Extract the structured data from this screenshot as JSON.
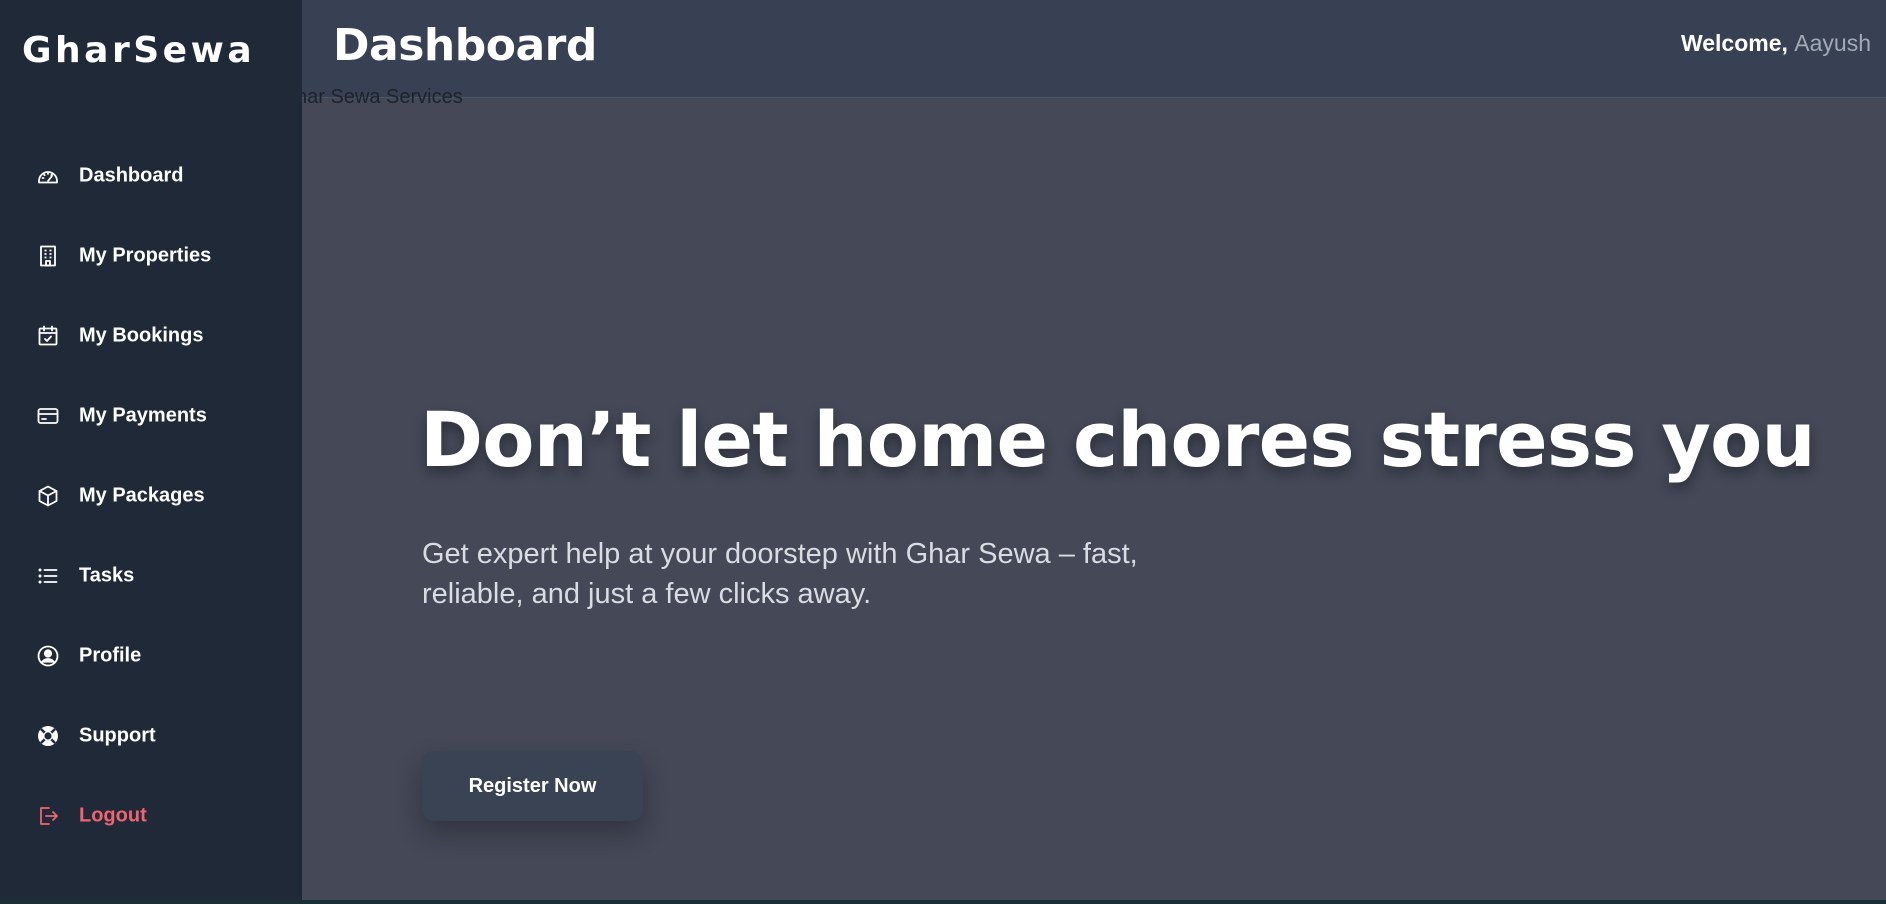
{
  "brand": {
    "name": "GharSewa"
  },
  "header": {
    "title": "Dashboard",
    "welcome_prefix": "Welcome,",
    "user_name": "Aayush"
  },
  "background_text": "har Sewa Services",
  "sidebar": {
    "items": [
      {
        "label": "Dashboard",
        "icon": "dashboard-gauge-icon"
      },
      {
        "label": "My Properties",
        "icon": "building-icon"
      },
      {
        "label": "My Bookings",
        "icon": "calendar-check-icon"
      },
      {
        "label": "My Payments",
        "icon": "credit-card-icon"
      },
      {
        "label": "My Packages",
        "icon": "box-icon"
      },
      {
        "label": "Tasks",
        "icon": "list-icon"
      },
      {
        "label": "Profile",
        "icon": "user-circle-icon"
      },
      {
        "label": "Support",
        "icon": "lifebuoy-icon"
      },
      {
        "label": "Logout",
        "icon": "logout-icon"
      }
    ]
  },
  "hero": {
    "title": "Don’t let home chores stress you",
    "subtitle": "Get expert help at your doorstep with Ghar Sewa – fast, reliable, and just a few clicks away.",
    "cta_label": "Register Now"
  },
  "colors": {
    "sidebar_bg": "#202938",
    "header_bg": "#384154",
    "main_bg": "#444857",
    "logout": "#f06470",
    "button_bg": "#3a4354"
  }
}
